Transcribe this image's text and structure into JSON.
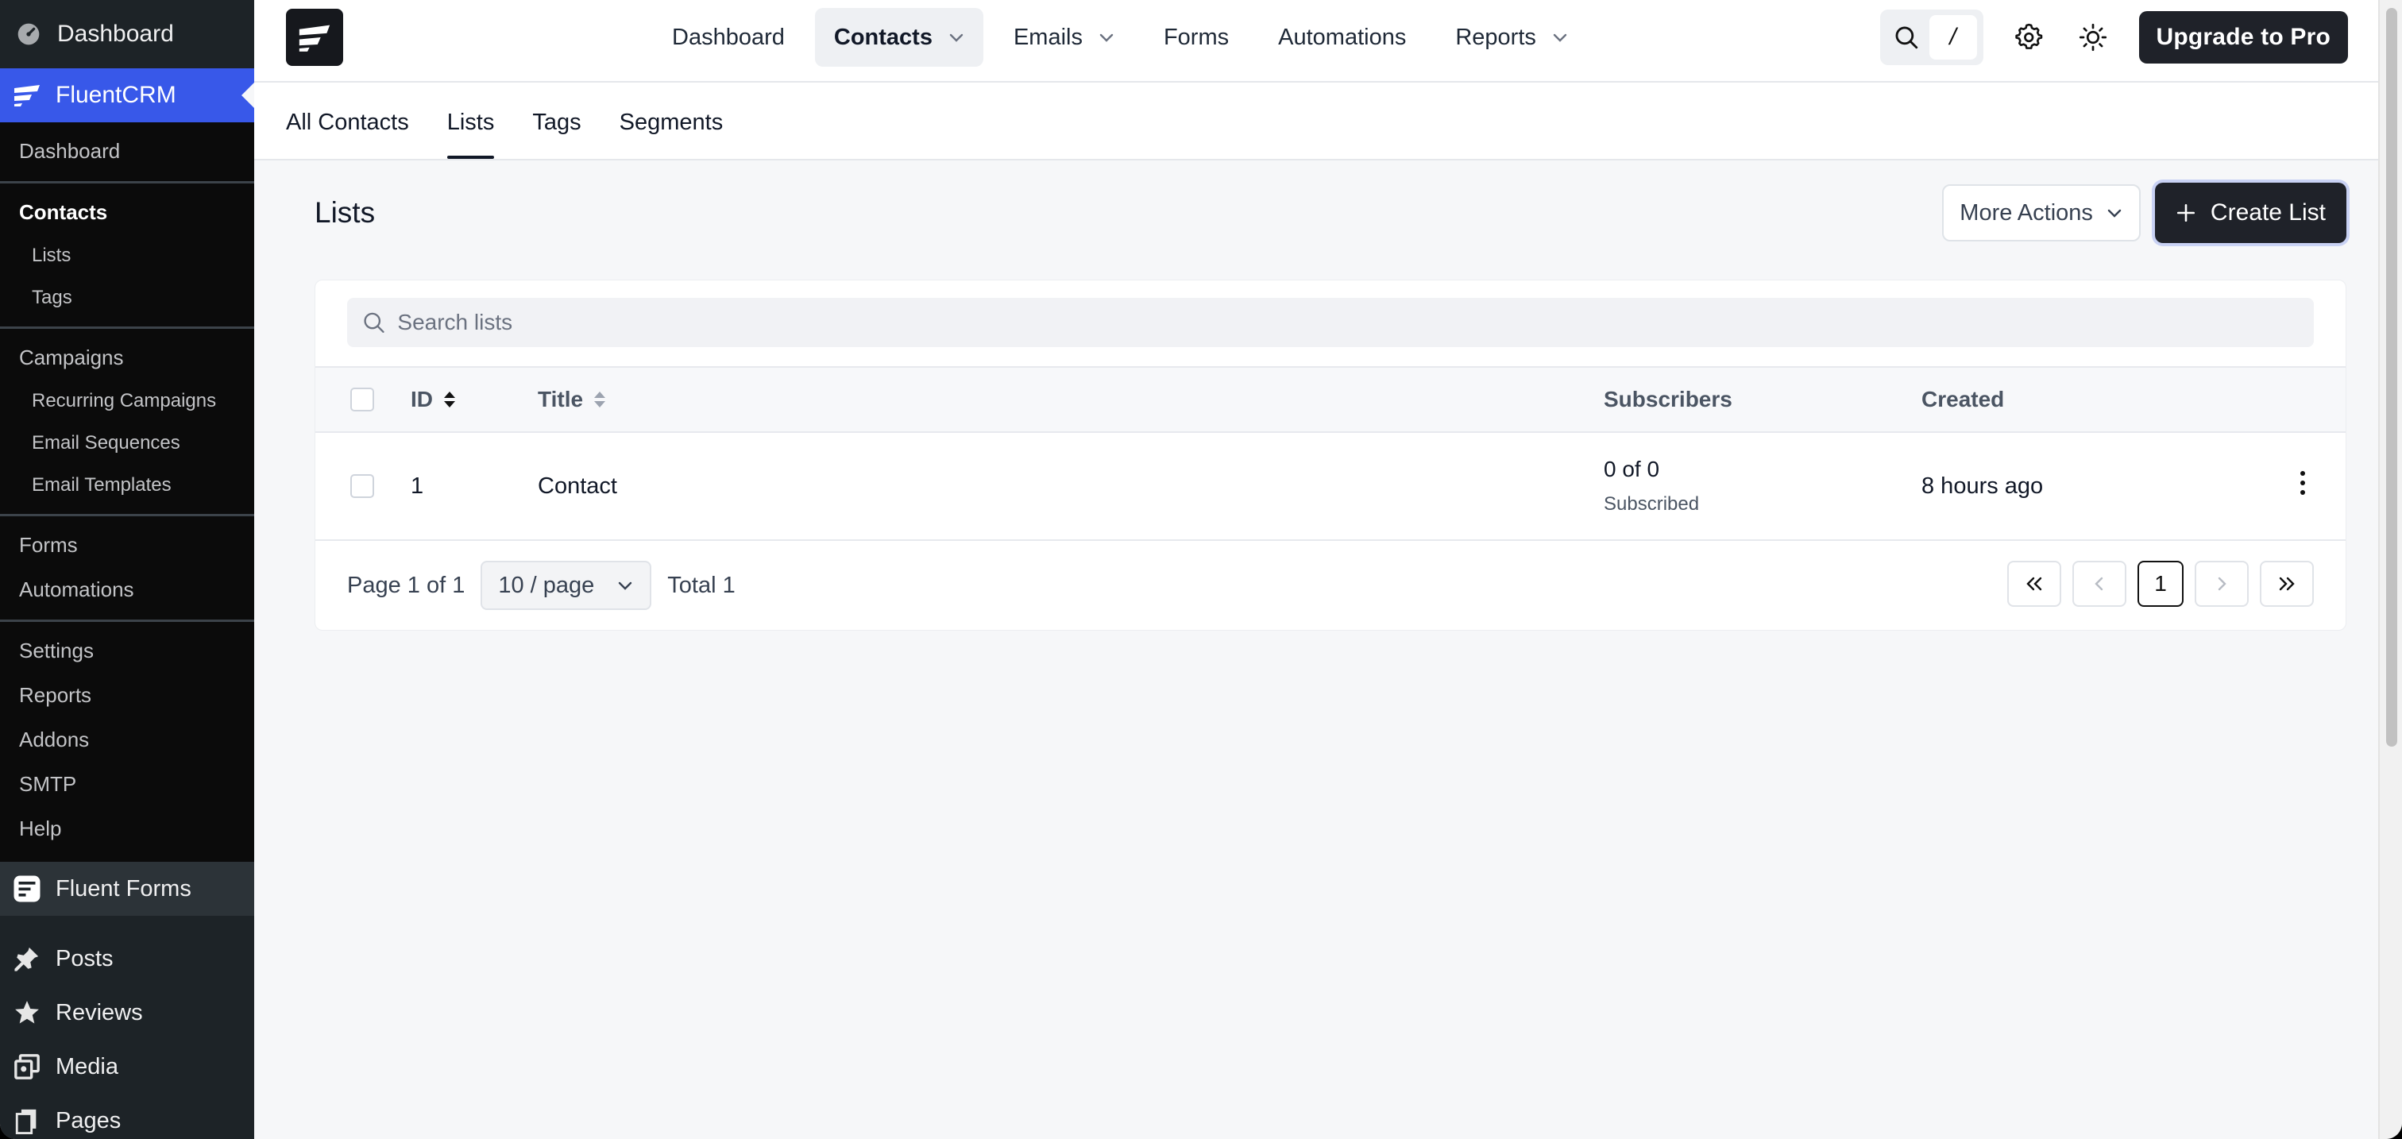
{
  "wp_sidebar": {
    "top_item": {
      "label": "Dashboard",
      "icon": "dashboard-gauge-icon"
    },
    "active_item": {
      "label": "FluentCRM",
      "icon": "fluentcrm-logo-icon"
    },
    "submenu": {
      "dashboard": "Dashboard",
      "contacts": "Contacts",
      "lists": "Lists",
      "tags": "Tags",
      "campaigns": "Campaigns",
      "recurring": "Recurring Campaigns",
      "sequences": "Email Sequences",
      "templates": "Email Templates",
      "forms": "Forms",
      "automations": "Automations",
      "settings": "Settings",
      "reports": "Reports",
      "addons": "Addons",
      "smtp": "SMTP",
      "help": "Help"
    },
    "menu": [
      {
        "label": "Fluent Forms",
        "icon": "fluent-forms-icon"
      },
      {
        "label": "Posts",
        "icon": "pushpin-icon"
      },
      {
        "label": "Reviews",
        "icon": "star-icon"
      },
      {
        "label": "Media",
        "icon": "media-icon"
      },
      {
        "label": "Pages",
        "icon": "pages-icon"
      }
    ]
  },
  "topnav": {
    "items": [
      "Dashboard",
      "Contacts",
      "Emails",
      "Forms",
      "Automations",
      "Reports"
    ],
    "active": "Contacts",
    "search_shortcut": "/",
    "upgrade_label": "Upgrade to Pro"
  },
  "subnav": {
    "tabs": [
      "All Contacts",
      "Lists",
      "Tags",
      "Segments"
    ],
    "active": "Lists"
  },
  "page": {
    "title": "Lists",
    "more_actions": "More Actions",
    "create_label": "Create List",
    "search_placeholder": "Search lists"
  },
  "table": {
    "headers": {
      "id": "ID",
      "title": "Title",
      "subscribers": "Subscribers",
      "created": "Created"
    },
    "rows": [
      {
        "id": "1",
        "title": "Contact",
        "subscribers": "0 of 0",
        "subscribers_sub": "Subscribed",
        "created": "8 hours ago"
      }
    ]
  },
  "pagination": {
    "page_text": "Page 1 of 1",
    "page_size": "10 / page",
    "total_text": "Total 1",
    "current_page": "1"
  },
  "colors": {
    "wp_sidebar_bg": "#1d2327",
    "wp_active": "#3858e9",
    "primary_dark": "#1f2229",
    "page_bg": "#f6f7f9"
  }
}
